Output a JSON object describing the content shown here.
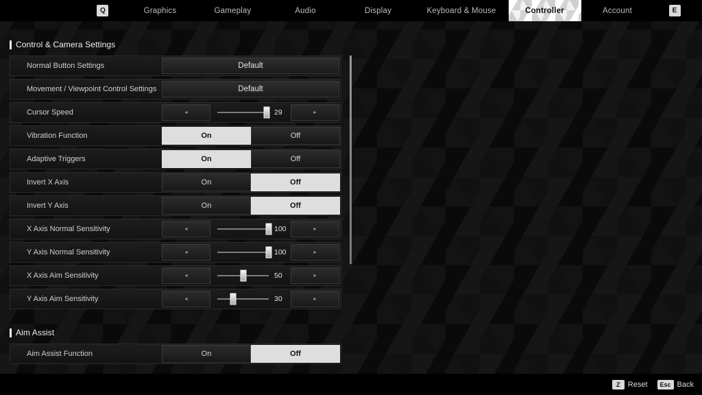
{
  "nav": {
    "left_key": "Q",
    "right_key": "E",
    "tabs": [
      {
        "label": "Graphics",
        "active": false
      },
      {
        "label": "Gameplay",
        "active": false
      },
      {
        "label": "Audio",
        "active": false
      },
      {
        "label": "Display",
        "active": false
      },
      {
        "label": "Keyboard & Mouse",
        "active": false
      },
      {
        "label": "Controller",
        "active": true
      },
      {
        "label": "Account",
        "active": false
      }
    ]
  },
  "sections": [
    {
      "title": "Control & Camera Settings",
      "rows": [
        {
          "label": "Normal Button Settings",
          "type": "value",
          "value": "Default"
        },
        {
          "label": "Movement / Viewpoint Control Settings",
          "type": "value",
          "value": "Default"
        },
        {
          "label": "Cursor Speed",
          "type": "slider",
          "value": "29",
          "percent": 96
        },
        {
          "label": "Vibration Function",
          "type": "toggle",
          "options": [
            "On",
            "Off"
          ],
          "selected": "On"
        },
        {
          "label": "Adaptive Triggers",
          "type": "toggle",
          "options": [
            "On",
            "Off"
          ],
          "selected": "On"
        },
        {
          "label": "Invert X Axis",
          "type": "toggle",
          "options": [
            "On",
            "Off"
          ],
          "selected": "Off"
        },
        {
          "label": "Invert Y Axis",
          "type": "toggle",
          "options": [
            "On",
            "Off"
          ],
          "selected": "Off"
        },
        {
          "label": "X Axis Normal Sensitivity",
          "type": "slider",
          "value": "100",
          "percent": 100
        },
        {
          "label": "Y Axis Normal Sensitivity",
          "type": "slider",
          "value": "100",
          "percent": 100
        },
        {
          "label": "X Axis Aim Sensitivity",
          "type": "slider",
          "value": "50",
          "percent": 50
        },
        {
          "label": "Y Axis Aim Sensitivity",
          "type": "slider",
          "value": "30",
          "percent": 30
        }
      ]
    },
    {
      "title": "Aim Assist",
      "rows": [
        {
          "label": "Aim Assist Function",
          "type": "toggle",
          "options": [
            "On",
            "Off"
          ],
          "selected": "Off"
        }
      ]
    }
  ],
  "slider_arrows": {
    "left": "◂",
    "right": "▸"
  },
  "footer": {
    "hints": [
      {
        "key": "Z",
        "label": "Reset"
      },
      {
        "key": "Esc",
        "label": "Back"
      }
    ]
  }
}
